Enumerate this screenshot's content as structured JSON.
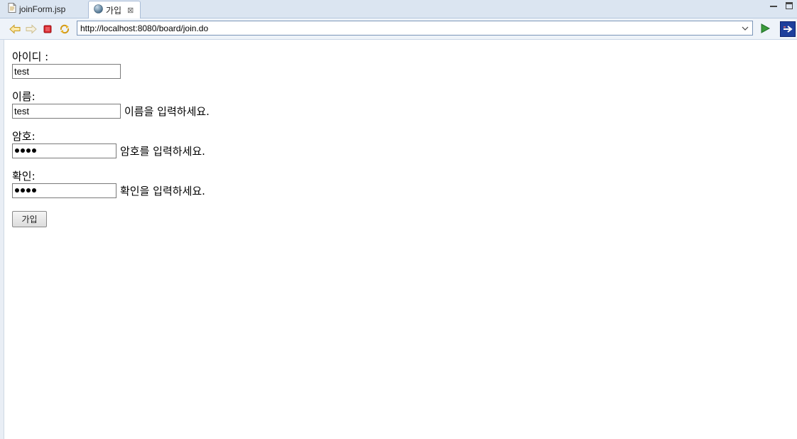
{
  "tabs": [
    {
      "label": "joinForm.jsp",
      "icon": "jsp-file-icon"
    },
    {
      "label": "가입",
      "icon": "globe-icon",
      "close": "⊠"
    }
  ],
  "toolbar": {
    "url": "http://localhost:8080/board/join.do"
  },
  "form": {
    "id": {
      "label": "아이디 :",
      "value": "test"
    },
    "name": {
      "label": "이름:",
      "value": "test",
      "hint": "이름을 입력하세요."
    },
    "password": {
      "label": "암호:",
      "masked_length": 4,
      "hint": "암호를 입력하세요."
    },
    "confirm": {
      "label": "확인:",
      "masked_length": 4,
      "hint": "확인을 입력하세요."
    },
    "submit_label": "가입"
  },
  "colors": {
    "tab_strip": "#dbe5f1",
    "toolbar": "#eef3f9",
    "go_green": "#3a9a3a",
    "stop_red": "#d9262c",
    "external_blue": "#1e3f9c"
  }
}
